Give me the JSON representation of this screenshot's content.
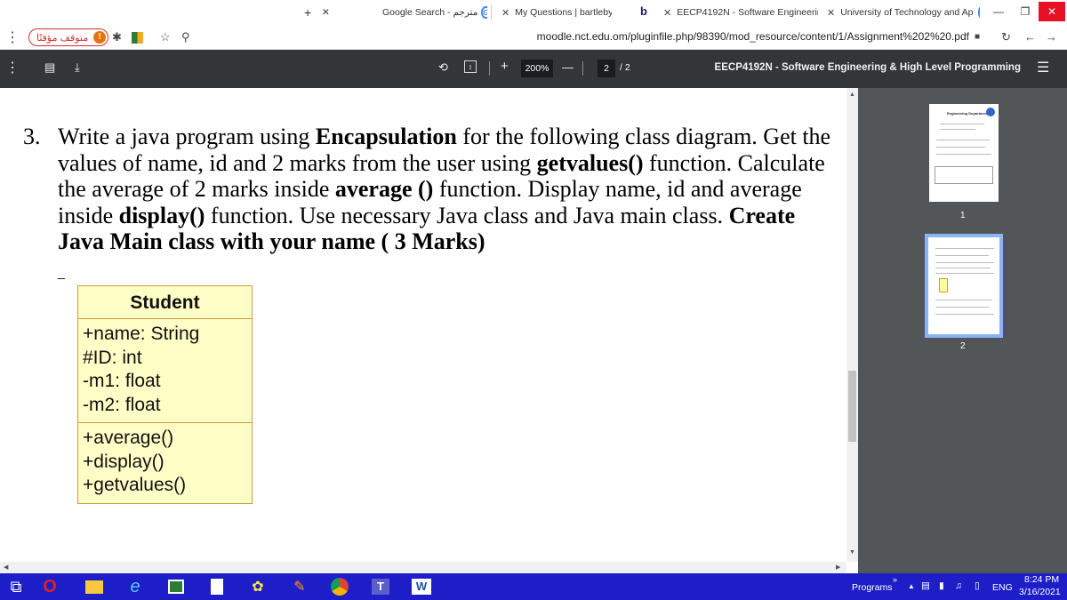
{
  "tabs": [
    {
      "title": "Google Search - مترجم",
      "icon": "google-icon"
    },
    {
      "title": "My Questions | bartleby",
      "icon": "bartleby-icon"
    },
    {
      "title": "EECP4192N - Software Engineerin",
      "icon": "moodle-icon"
    },
    {
      "title": "University of Technology and Ap",
      "icon": "university-icon"
    }
  ],
  "browser": {
    "url": "moodle.nct.edu.om/pluginfile.php/98390/mod_resource/content/1/Assignment%202%20.pdf",
    "paused_label": "متوقف مؤقتًا",
    "paused_badge": "!"
  },
  "pdf_toolbar": {
    "zoom": "200%",
    "page_current": "2",
    "page_total": "/  2",
    "title": "EECP4192N - Software Engineering & High Level Programming"
  },
  "document": {
    "question_number": "3.",
    "q_part1": "Write a java program using ",
    "q_bold1": "Encapsulation",
    "q_part2": " for the following class diagram. Get the values of name, id and 2 marks from the user using ",
    "q_bold2": "getvalues()",
    "q_part3": " function. Calculate the average of 2 marks inside ",
    "q_bold3": "average ()",
    "q_part4": " function. Display name, id and average inside ",
    "q_bold4": "display()",
    "q_part5": " function. Use necessary Java class and Java main class. ",
    "q_bold5": "Create Java Main class with your name ( 3 Marks)",
    "dash": "_"
  },
  "uml": {
    "class_name": "Student",
    "attributes": [
      "+name: String",
      "#ID: int",
      "-m1: float",
      "-m2: float"
    ],
    "operations": [
      "+average()",
      "+display()",
      "+getvalues()"
    ]
  },
  "thumbnails": {
    "page1_label": "1",
    "page2_label": "2",
    "page1_heading": "Engineering Department"
  },
  "taskbar": {
    "programs_label": "Programs",
    "chevron": "»",
    "language": "ENG",
    "time": "8:24 PM",
    "date": "3/16/2021"
  },
  "colors": {
    "pdf_toolbar_bg": "#323639",
    "thumb_panel_bg": "#525659",
    "uml_fill": "#fefec6",
    "taskbar_bg": "#1e1ec8",
    "selected_thumb_border": "#8ab4f8"
  }
}
